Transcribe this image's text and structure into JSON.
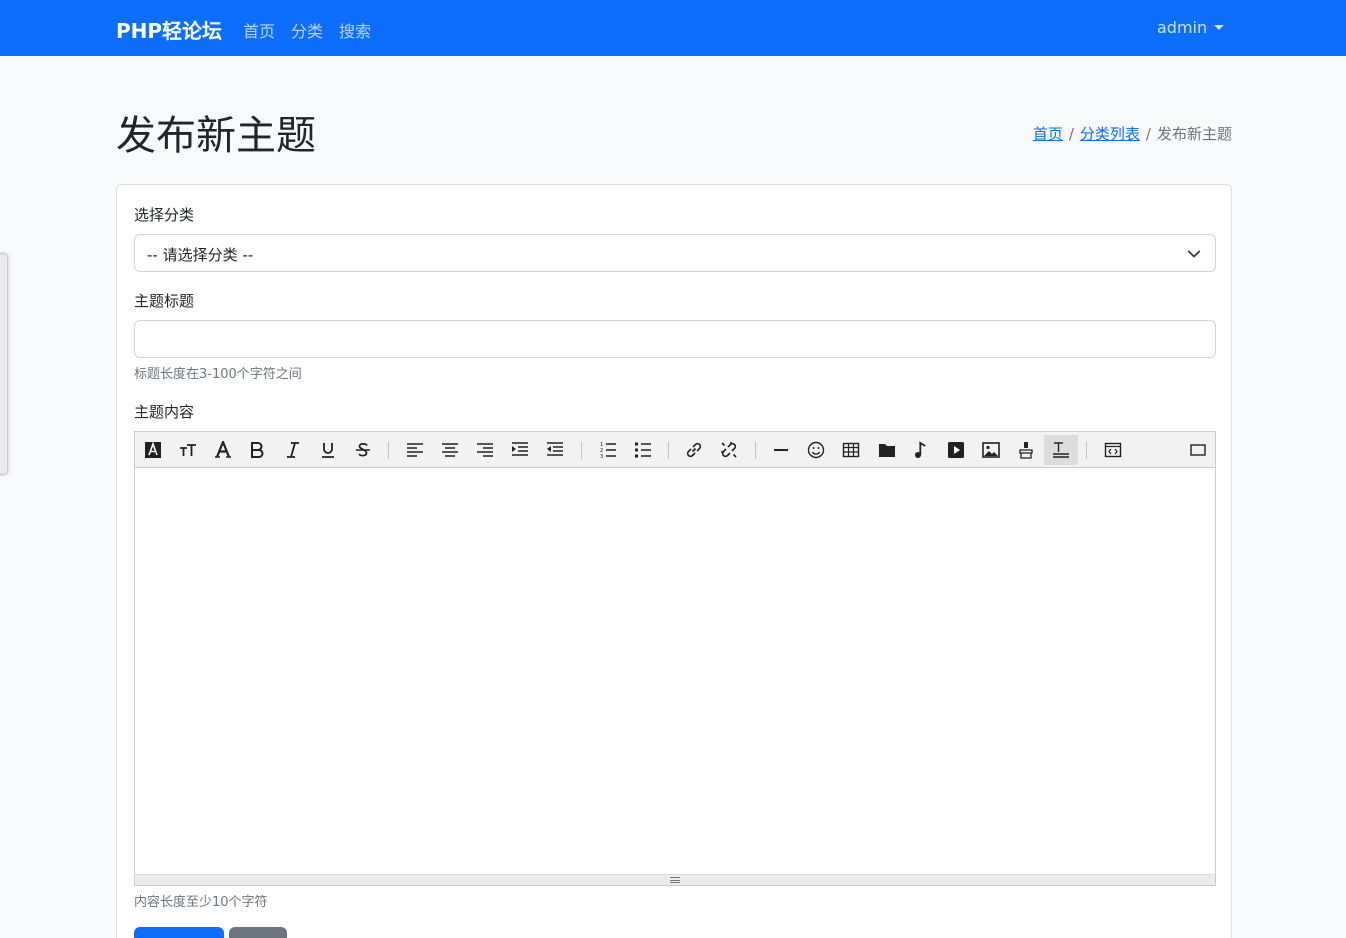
{
  "navbar": {
    "brand": "PHP轻论坛",
    "links": [
      "首页",
      "分类",
      "搜索"
    ],
    "user": "admin"
  },
  "page": {
    "title": "发布新主题",
    "breadcrumb": [
      "首页",
      "分类列表",
      "发布新主题"
    ]
  },
  "form": {
    "category_label": "选择分类",
    "category_selected": "-- 请选择分类 --",
    "title_label": "主题标题",
    "title_value": "",
    "title_help": "标题长度在3-100个字符之间",
    "content_label": "主题内容",
    "content_help": "内容长度至少10个字符"
  },
  "editor": {
    "toolbar_icons": [
      "font-color-icon",
      "font-size-icon",
      "font-family-icon",
      "bold-icon",
      "italic-icon",
      "underline-icon",
      "strikethrough-icon",
      "align-left-icon",
      "align-center-icon",
      "align-right-icon",
      "indent-icon",
      "outdent-icon",
      "ordered-list-icon",
      "unordered-list-icon",
      "link-icon",
      "unlink-icon",
      "horizontal-rule-icon",
      "emoticon-icon",
      "table-icon",
      "folder-icon",
      "music-icon",
      "video-icon",
      "image-icon",
      "format-brush-icon",
      "clear-format-icon",
      "source-code-icon",
      "fullscreen-icon"
    ]
  },
  "colors": {
    "primary": "#0d6efd",
    "secondary": "#6c757d",
    "background": "#f8f9fa"
  }
}
